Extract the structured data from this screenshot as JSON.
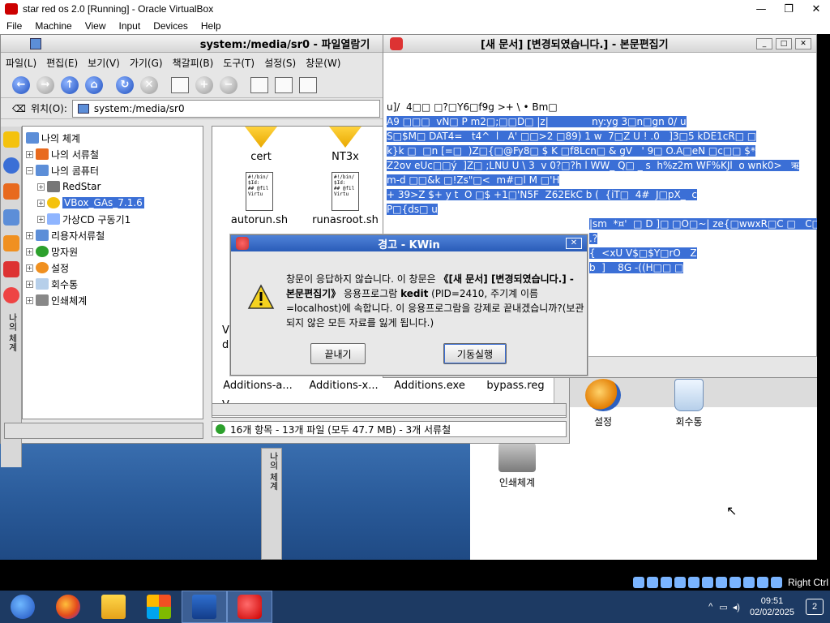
{
  "vbox": {
    "title": "star red os 2.0 [Running] - Oracle VirtualBox",
    "controls": [
      "—",
      "❐",
      "✕"
    ],
    "menu": [
      "File",
      "Machine",
      "View",
      "Input",
      "Devices",
      "Help"
    ],
    "host_key": "Right Ctrl"
  },
  "file_manager": {
    "title": "system:/media/sr0 - 파일열람기",
    "menu": [
      "파일(L)",
      "편집(E)",
      "보기(V)",
      "가기(G)",
      "책갈피(B)",
      "도구(T)",
      "설정(S)",
      "창문(W)"
    ],
    "location_label": "위치(O):",
    "location_value": "system:/media/sr0",
    "side_tab": "나의 체계",
    "tree": [
      {
        "label": "나의 체계",
        "level": 0,
        "expander": ""
      },
      {
        "label": "나의 서류철",
        "level": 1,
        "expander": "+"
      },
      {
        "label": "나의 콤퓨터",
        "level": 1,
        "expander": "−"
      },
      {
        "label": "RedStar",
        "level": 2,
        "expander": "+"
      },
      {
        "label": "VBox_GAs_7.1.6",
        "level": 2,
        "expander": "+",
        "selected": true
      },
      {
        "label": "가상CD 구동기1",
        "level": 2,
        "expander": "+"
      },
      {
        "label": "리용자서류철",
        "level": 1,
        "expander": "+"
      },
      {
        "label": "망자원",
        "level": 1,
        "expander": "+"
      },
      {
        "label": "설정",
        "level": 1,
        "expander": "+"
      },
      {
        "label": "회수통",
        "level": 1,
        "expander": "+"
      },
      {
        "label": "인쇄체계",
        "level": 1,
        "expander": "+"
      }
    ],
    "files_top": [
      {
        "name": "cert",
        "type": "folder"
      },
      {
        "name": "NT3x",
        "type": "folder"
      },
      {
        "name": "autorun.sh",
        "type": "script"
      },
      {
        "name": "runasroot.sh",
        "type": "script"
      }
    ],
    "script_preview": "#!/bin/\n$Id:\n## @fil\nVirtu",
    "files_bottom": [
      "Additions-a...",
      "Additions-x...",
      "Additions.exe",
      "bypass.reg"
    ],
    "partial_labels": [
      "V",
      "VI",
      "d",
      "V"
    ],
    "status": "16개 항목 - 13개 파일 (모두 47.7 MB) - 3개 서류철"
  },
  "editor": {
    "title": "[새 문서] [변경되였습니다.] - 본문편집기",
    "lines": [
      {
        "text": "u]/  4□□ □?□Y6□f9g >+ \\ • Bm□",
        "hl": false
      },
      {
        "text": "A9 □□□  vN□ P m2□;□□D□ |z|              ny:yg 3□n□gn 0/ u",
        "hl": true
      },
      {
        "text": "S□$M□ DAT4=   t4^  l   A' □□>2 □89) 1 w  7□Z U ! .0   ]3□5 kDE1cR□ □",
        "hl": true
      },
      {
        "text": "k}k □  □n [=□  )Z□{□@Fy8□ $ K □f8Lcn□ & gV   ' 9□ O.A□eN □c□□ $*",
        "hl": true
      },
      {
        "text": "Z2ov eUc□□ý  ]Z□ ;LNU U \\ 3  v 0?□?h l WW_ Q□ _ s  h%z2m WF%KJl  o wnk0>   ऋ",
        "hl": true
      },
      {
        "text": "m-d □□&k □!Zs\"□<  m#□l M □'H",
        "hl": true
      },
      {
        "text": "+ 39>Z $+ y t  O □$ +1□'N5F  Z62EkC b (  {iT□  4#  J□pX_  c",
        "hl": true
      },
      {
        "text": "P□{ds□ u",
        "hl": true
      }
    ],
    "fragments": [
      "|sm  *¤'  □ D ]□ □O□~| ze{□wwxR□C □   C□",
      ".?",
      "{  <xU V$□$Y□rO   Z",
      "b  ]    8G -((H□□ □"
    ]
  },
  "dialog": {
    "title": "경고 - KWin",
    "message_pre": "창문이 응답하지 않습니다. 이 창문은 ",
    "message_bold": "《[새 문서] [변경되였습니다.] - 본문편집기》",
    "message_mid": " 응용프로그람 ",
    "message_app": "kedit",
    "message_post": " (PID=2410, 주기계 이름=localhost)에 속합니다. 이 응용프로그람을 강제로 끝내겠습니까?(보관되지 않은 모든 자료를 잃게 됩니다.)",
    "btn_kill": "끝내기",
    "btn_continue": "기동실행",
    "close": "✕"
  },
  "desktop": {
    "icons": [
      "설정",
      "회수통",
      "인쇄체계"
    ],
    "side_tab": "나의 체계"
  },
  "taskbar": {
    "time": "09:51",
    "date": "02/02/2025",
    "notifications": "2"
  }
}
